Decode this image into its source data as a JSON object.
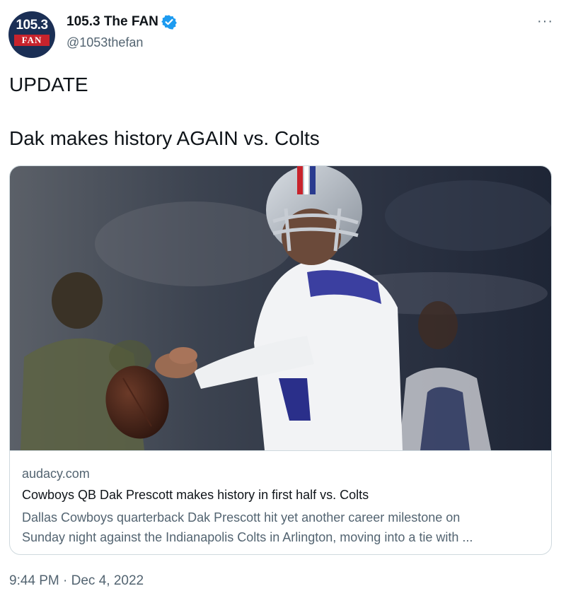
{
  "account": {
    "display_name": "105.3 The FAN",
    "handle": "@1053thefan",
    "avatar_text_top": "105.3",
    "avatar_text_band": "FAN",
    "verified_icon": "verified-badge-icon",
    "more_label": "···"
  },
  "tweet": {
    "line1": "UPDATE",
    "line2": "Dak makes history AGAIN vs. Colts",
    "timestamp": "9:44 PM · Dec 4, 2022"
  },
  "card": {
    "domain": "audacy.com",
    "title": "Cowboys QB Dak Prescott makes history in first half vs. Colts",
    "description_line1": "Dallas Cowboys quarterback Dak Prescott hit yet another career milestone on",
    "description_line2": "Sunday night against the Indianapolis Colts in Arlington, moving into a tie with ...",
    "image_subject": "football-quarterback-photo"
  },
  "colors": {
    "text_primary": "#0f1419",
    "text_secondary": "#536471",
    "border": "#cfd9de",
    "verified_blue": "#1d9bf0",
    "avatar_navy": "#1b2f55",
    "avatar_red": "#c8232c"
  }
}
